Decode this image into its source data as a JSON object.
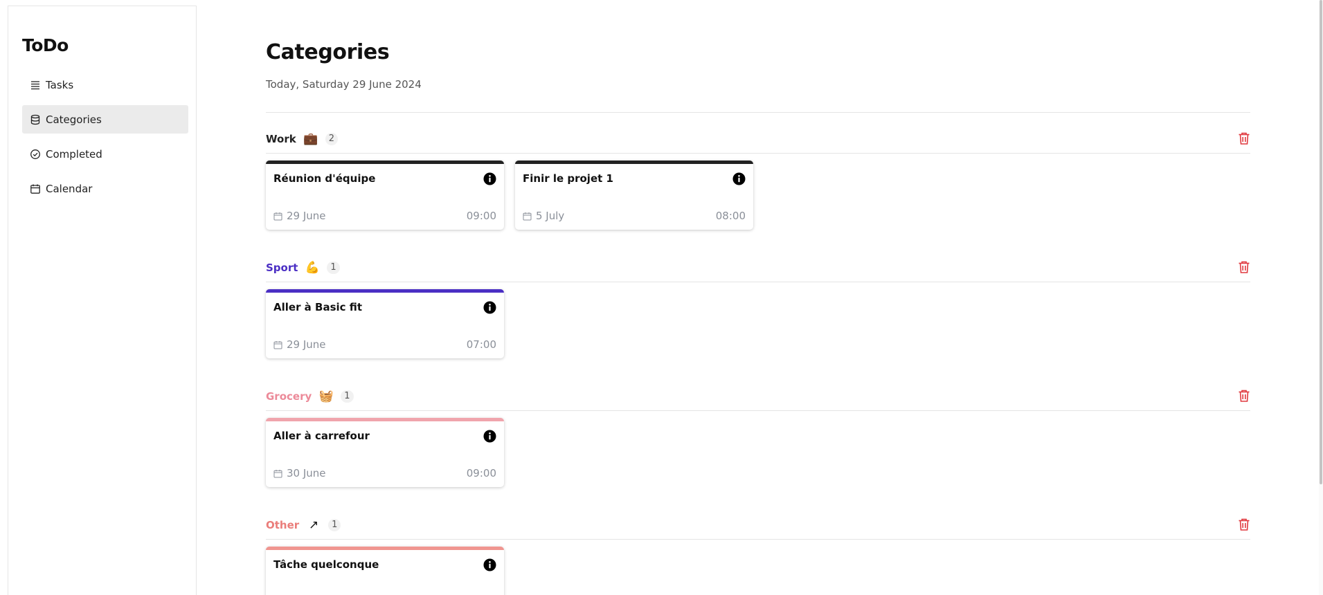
{
  "sidebar": {
    "brand": "ToDo",
    "items": [
      {
        "label": "Tasks",
        "icon": "list-icon",
        "active": false
      },
      {
        "label": "Categories",
        "icon": "database-icon",
        "active": true
      },
      {
        "label": "Completed",
        "icon": "check-circle-icon",
        "active": false
      },
      {
        "label": "Calendar",
        "icon": "calendar-icon",
        "active": false
      }
    ]
  },
  "main": {
    "title": "Categories",
    "date": "Today, Saturday 29 June 2024"
  },
  "categories": [
    {
      "name": "Work",
      "emoji": "💼",
      "count": "2",
      "color": "#222222",
      "name_color": "#222222",
      "tasks": [
        {
          "title": "Réunion d'équipe",
          "date": "29 June",
          "time": "09:00"
        },
        {
          "title": "Finir le projet 1",
          "date": "5 July",
          "time": "08:00"
        }
      ]
    },
    {
      "name": "Sport",
      "emoji": "💪",
      "count": "1",
      "color": "#4b2fc4",
      "name_color": "#4b2fc4",
      "tasks": [
        {
          "title": "Aller à Basic fit",
          "date": "29 June",
          "time": "07:00"
        }
      ]
    },
    {
      "name": "Grocery",
      "emoji": "🧺",
      "count": "1",
      "color": "#f0a4ac",
      "name_color": "#ec8a99",
      "tasks": [
        {
          "title": "Aller à carrefour",
          "date": "30 June",
          "time": "09:00"
        }
      ]
    },
    {
      "name": "Other",
      "emoji": "↗",
      "count": "1",
      "color": "#f09590",
      "name_color": "#ea7d7a",
      "tasks": [
        {
          "title": "Tâche quelconque",
          "date": "",
          "time": ""
        }
      ]
    }
  ],
  "colors": {
    "delete": "#e0383e",
    "muted": "#8a8f98",
    "active_nav": "#ebebeb"
  }
}
